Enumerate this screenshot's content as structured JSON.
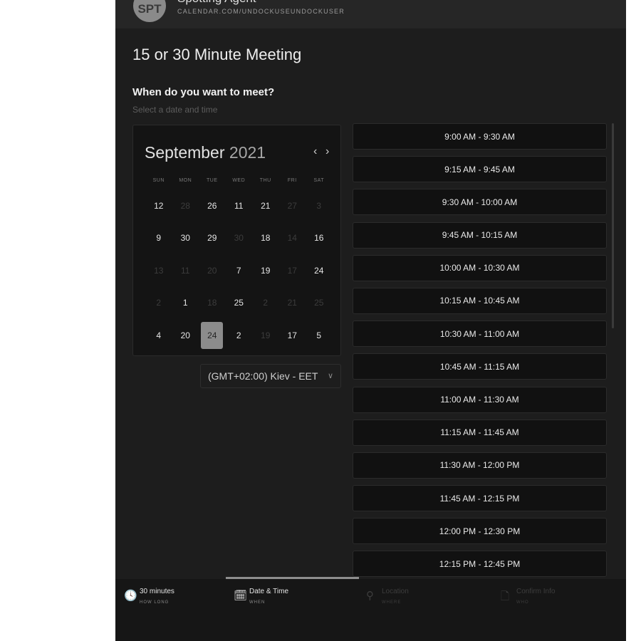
{
  "header": {
    "avatar_initials": "SPT",
    "host_name": "Spotting Agent",
    "url": "CALENDAR.COM/UNDOCKUSEUNDOCKUSER"
  },
  "event_title": "15 or 30 Minute Meeting",
  "question": "When do you want to meet?",
  "hint": "Select a date and time",
  "calendar": {
    "month": "September",
    "year": "2021",
    "prev_icon": "‹",
    "next_icon": "›",
    "weekdays": [
      "SUN",
      "MON",
      "TUE",
      "WED",
      "THU",
      "FRI",
      "SAT"
    ],
    "weeks": [
      [
        {
          "d": "12",
          "dim": false
        },
        {
          "d": "28",
          "dim": true
        },
        {
          "d": "26",
          "dim": false
        },
        {
          "d": "11",
          "dim": false
        },
        {
          "d": "21",
          "dim": false
        },
        {
          "d": "27",
          "dim": true
        },
        {
          "d": "3",
          "dim": true
        }
      ],
      [
        {
          "d": "9",
          "dim": false
        },
        {
          "d": "30",
          "dim": false
        },
        {
          "d": "29",
          "dim": false
        },
        {
          "d": "30",
          "dim": true
        },
        {
          "d": "18",
          "dim": false
        },
        {
          "d": "14",
          "dim": true
        },
        {
          "d": "16",
          "dim": false
        }
      ],
      [
        {
          "d": "13",
          "dim": true
        },
        {
          "d": "11",
          "dim": true
        },
        {
          "d": "20",
          "dim": true
        },
        {
          "d": "7",
          "dim": false
        },
        {
          "d": "19",
          "dim": false
        },
        {
          "d": "17",
          "dim": true
        },
        {
          "d": "24",
          "dim": false
        }
      ],
      [
        {
          "d": "2",
          "dim": true
        },
        {
          "d": "1",
          "dim": false
        },
        {
          "d": "18",
          "dim": true
        },
        {
          "d": "25",
          "dim": false
        },
        {
          "d": "2",
          "dim": true
        },
        {
          "d": "21",
          "dim": true
        },
        {
          "d": "25",
          "dim": true
        }
      ],
      [
        {
          "d": "4",
          "dim": false
        },
        {
          "d": "20",
          "dim": false
        },
        {
          "d": "24",
          "dim": false,
          "selected": true
        },
        {
          "d": "2",
          "dim": false
        },
        {
          "d": "19",
          "dim": true
        },
        {
          "d": "17",
          "dim": false
        },
        {
          "d": "5",
          "dim": false
        }
      ]
    ]
  },
  "timezone": {
    "label": "(GMT+02:00) Kiev - EET",
    "chevron": "∨"
  },
  "slots": [
    "9:00 AM - 9:30 AM",
    "9:15 AM - 9:45 AM",
    "9:30 AM - 10:00 AM",
    "9:45 AM - 10:15 AM",
    "10:00 AM - 10:30 AM",
    "10:15 AM - 10:45 AM",
    "10:30 AM - 11:00 AM",
    "10:45 AM - 11:15 AM",
    "11:00 AM - 11:30 AM",
    "11:15 AM - 11:45 AM",
    "11:30 AM - 12:00 PM",
    "11:45 AM - 12:15 PM",
    "12:00 PM - 12:30 PM",
    "12:15 PM - 12:45 PM"
  ],
  "steps": [
    {
      "label": "30 minutes",
      "sub": "HOW LONG",
      "icon": "clock-icon",
      "glyph": "🕓",
      "active": true
    },
    {
      "label": "Date & Time",
      "sub": "WHEN",
      "icon": "calendar-icon",
      "glyph": "🗓",
      "active": true
    },
    {
      "label": "Location",
      "sub": "WHERE",
      "icon": "location-pin-icon",
      "glyph": "⚲",
      "active": false
    },
    {
      "label": "Confirm Info",
      "sub": "WHO",
      "icon": "document-icon",
      "glyph": "🗋",
      "active": false
    }
  ]
}
